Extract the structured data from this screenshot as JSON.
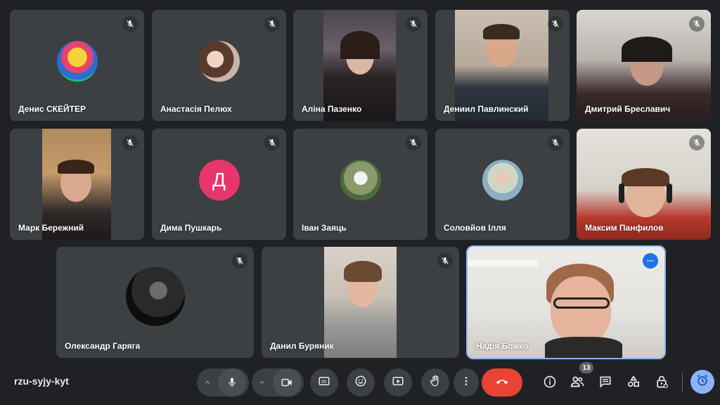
{
  "participants": [
    {
      "name": "Денис СКЕЙТЕР",
      "muted": true,
      "view": "avatar"
    },
    {
      "name": "Анастасія Пелюх",
      "muted": true,
      "view": "avatar"
    },
    {
      "name": "Аліна Пазенко",
      "muted": true,
      "view": "video"
    },
    {
      "name": "Дениил Павлинский",
      "muted": true,
      "view": "video"
    },
    {
      "name": "Дмитрий Бреславич",
      "muted": true,
      "view": "video"
    },
    {
      "name": "Марк Бережний",
      "muted": true,
      "view": "video"
    },
    {
      "name": "Дима Пушкарь",
      "muted": true,
      "view": "avatar",
      "initial": "Д"
    },
    {
      "name": "Іван Заяць",
      "muted": true,
      "view": "avatar"
    },
    {
      "name": "Соловйов Ілля",
      "muted": true,
      "view": "avatar"
    },
    {
      "name": "Максим Панфилов",
      "muted": true,
      "view": "video"
    },
    {
      "name": "Олександр Гаряга",
      "muted": true,
      "view": "avatar"
    },
    {
      "name": "Данил Буряник",
      "muted": true,
      "view": "video"
    },
    {
      "name": "Надія Божко",
      "muted": false,
      "view": "video",
      "active": true
    }
  ],
  "toolbar": {
    "meeting_code": "rzu-syjy-kyt",
    "people_count": "13",
    "icons": [
      "chevron-up-icon",
      "microphone-icon",
      "camera-icon",
      "captions-icon",
      "emoji-icon",
      "present-icon",
      "raise-hand-icon",
      "more-options-icon",
      "hang-up-icon",
      "info-icon",
      "people-icon",
      "chat-icon",
      "activities-icon",
      "host-controls-icon",
      "timer-icon"
    ]
  },
  "colors": {
    "background": "#202124",
    "tile": "#3c4043",
    "hangup": "#ea4335",
    "accent": "#8ab4f8",
    "avatar_pink": "#e8356b"
  }
}
